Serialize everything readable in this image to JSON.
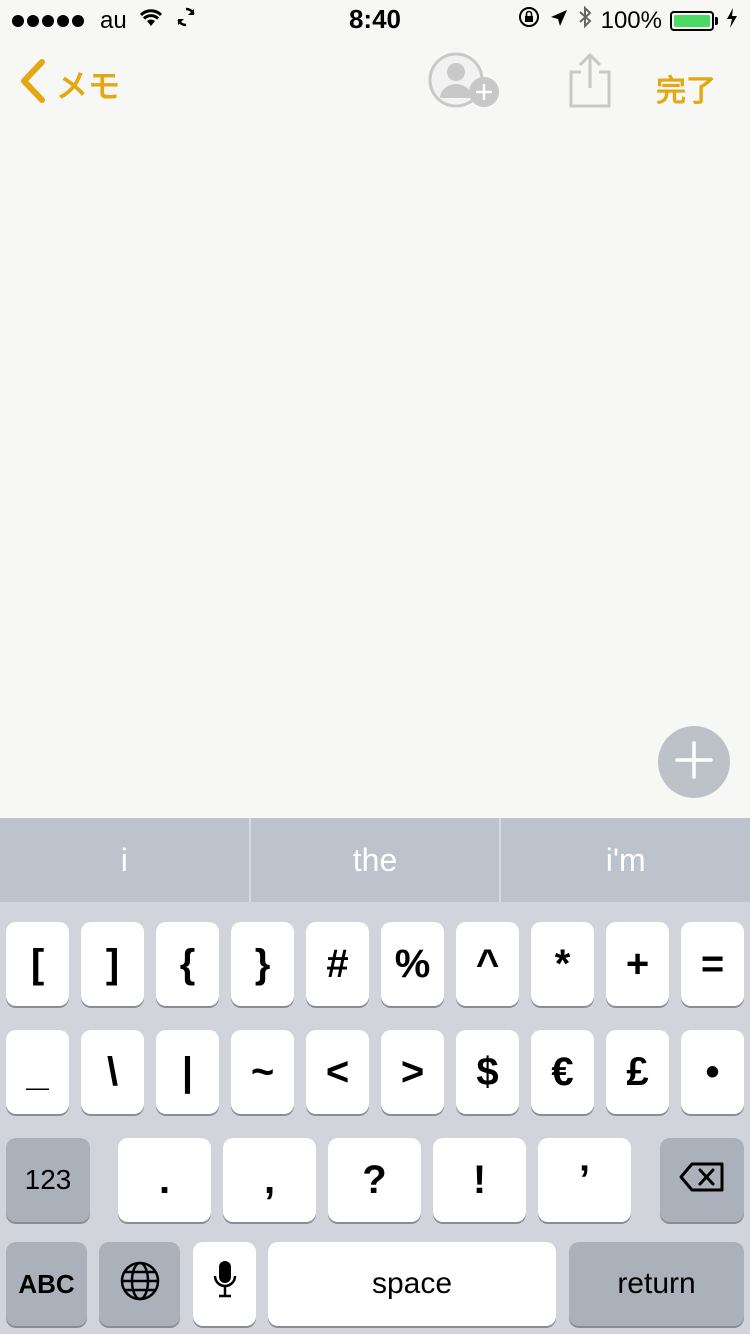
{
  "status_bar": {
    "carrier": "au",
    "time": "8:40",
    "battery_percent": "100%",
    "battery_level": 1.0,
    "icons": [
      "signal-dots",
      "wifi-icon",
      "sync-icon",
      "rotation-lock-icon",
      "location-icon",
      "bluetooth-icon",
      "battery-icon",
      "charging-icon"
    ]
  },
  "nav": {
    "back_label": "メモ",
    "done_label": "完了",
    "accent_color": "#e3a812"
  },
  "suggestions": [
    "i",
    "the",
    "i'm"
  ],
  "keyboard": {
    "row1": [
      "[",
      "]",
      "{",
      "}",
      "#",
      "%",
      "^",
      "*",
      "+",
      "="
    ],
    "row2": [
      "_",
      "\\",
      "|",
      "~",
      "<",
      ">",
      "$",
      "€",
      "£",
      "•"
    ],
    "row3": {
      "mode": "123",
      "keys": [
        ".",
        ",",
        "?",
        "!",
        "’"
      ]
    },
    "row4": {
      "abc": "ABC",
      "space": "space",
      "return": "return"
    }
  }
}
